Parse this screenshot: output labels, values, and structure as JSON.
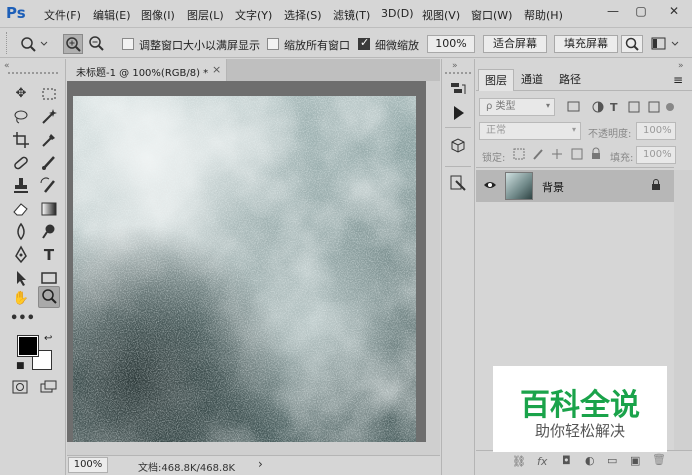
{
  "app": {
    "logo": "Ps"
  },
  "menu": [
    "文件(F)",
    "编辑(E)",
    "图像(I)",
    "图层(L)",
    "文字(Y)",
    "选择(S)",
    "滤镜(T)",
    "3D(D)",
    "视图(V)",
    "窗口(W)",
    "帮助(H)"
  ],
  "window_controls": {
    "minimize": "—",
    "restore": "▢",
    "close": "✕"
  },
  "options": {
    "resize_windows": "调整窗口大小以满屏显示",
    "zoom_all": "缩放所有窗口",
    "scrubby_zoom": "细微缩放",
    "zoom_value": "100%",
    "fit_screen": "适合屏幕",
    "fill_screen": "填充屏幕"
  },
  "document": {
    "tab_title": "未标题-1 @ 100%(RGB/8) *",
    "close": "×"
  },
  "status": {
    "zoom": "100%",
    "doc_info": "文档:468.8K/468.8K",
    "arrow": "›"
  },
  "layers_panel": {
    "tabs": [
      "图层",
      "通道",
      "路径"
    ],
    "filter_kind": "ρ 类型",
    "blend_mode": "正常",
    "opacity_label": "不透明度:",
    "opacity_value": "100%",
    "lock_label": "锁定:",
    "fill_label": "填充:",
    "fill_value": "100%",
    "layer_name": "背景",
    "bottom_icons": [
      "⛓",
      "fx",
      "◘",
      "◐",
      "▭",
      "▣",
      "🗑"
    ]
  },
  "watermark": {
    "title": "百科全说",
    "subtitle": "助你轻松解决"
  },
  "colors": {
    "accent_logo": "#1d5fb8",
    "watermark_green": "#1aa34a"
  }
}
